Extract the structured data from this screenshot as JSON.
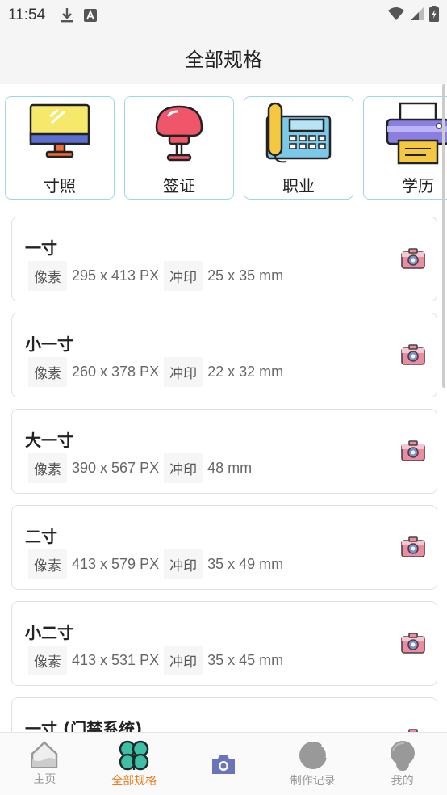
{
  "status": {
    "time": "11:54"
  },
  "header": {
    "title": "全部规格"
  },
  "categories": [
    {
      "label": "寸照",
      "icon": "monitor-icon"
    },
    {
      "label": "签证",
      "icon": "chair-icon"
    },
    {
      "label": "职业",
      "icon": "telephone-icon"
    },
    {
      "label": "学历",
      "icon": "printer-icon"
    }
  ],
  "labels": {
    "pixel": "像素",
    "print": "冲印"
  },
  "specs": [
    {
      "name": "一寸",
      "pixels": "295 x 413 PX",
      "print": "25 x 35 mm"
    },
    {
      "name": "小一寸",
      "pixels": "260 x 378 PX",
      "print": "22 x 32 mm"
    },
    {
      "name": "大一寸",
      "pixels": "390 x 567 PX",
      "print": "48 mm"
    },
    {
      "name": "二寸",
      "pixels": "413 x 579 PX",
      "print": "35 x 49 mm"
    },
    {
      "name": "小二寸",
      "pixels": "413 x 531 PX",
      "print": "35 x 45 mm"
    },
    {
      "name": "一寸 (门禁系统)",
      "pixels": "",
      "print": ""
    }
  ],
  "tabs": [
    {
      "label": "主页",
      "icon": "home-icon"
    },
    {
      "label": "全部规格",
      "icon": "clover-icon",
      "active": true
    },
    {
      "label": "",
      "icon": "camera-icon"
    },
    {
      "label": "制作记录",
      "icon": "history-icon"
    },
    {
      "label": "我的",
      "icon": "profile-icon"
    }
  ],
  "colors": {
    "accent": "#f07a1a",
    "card_border": "#e2e2e2",
    "category_border": "#9fd6e6"
  }
}
